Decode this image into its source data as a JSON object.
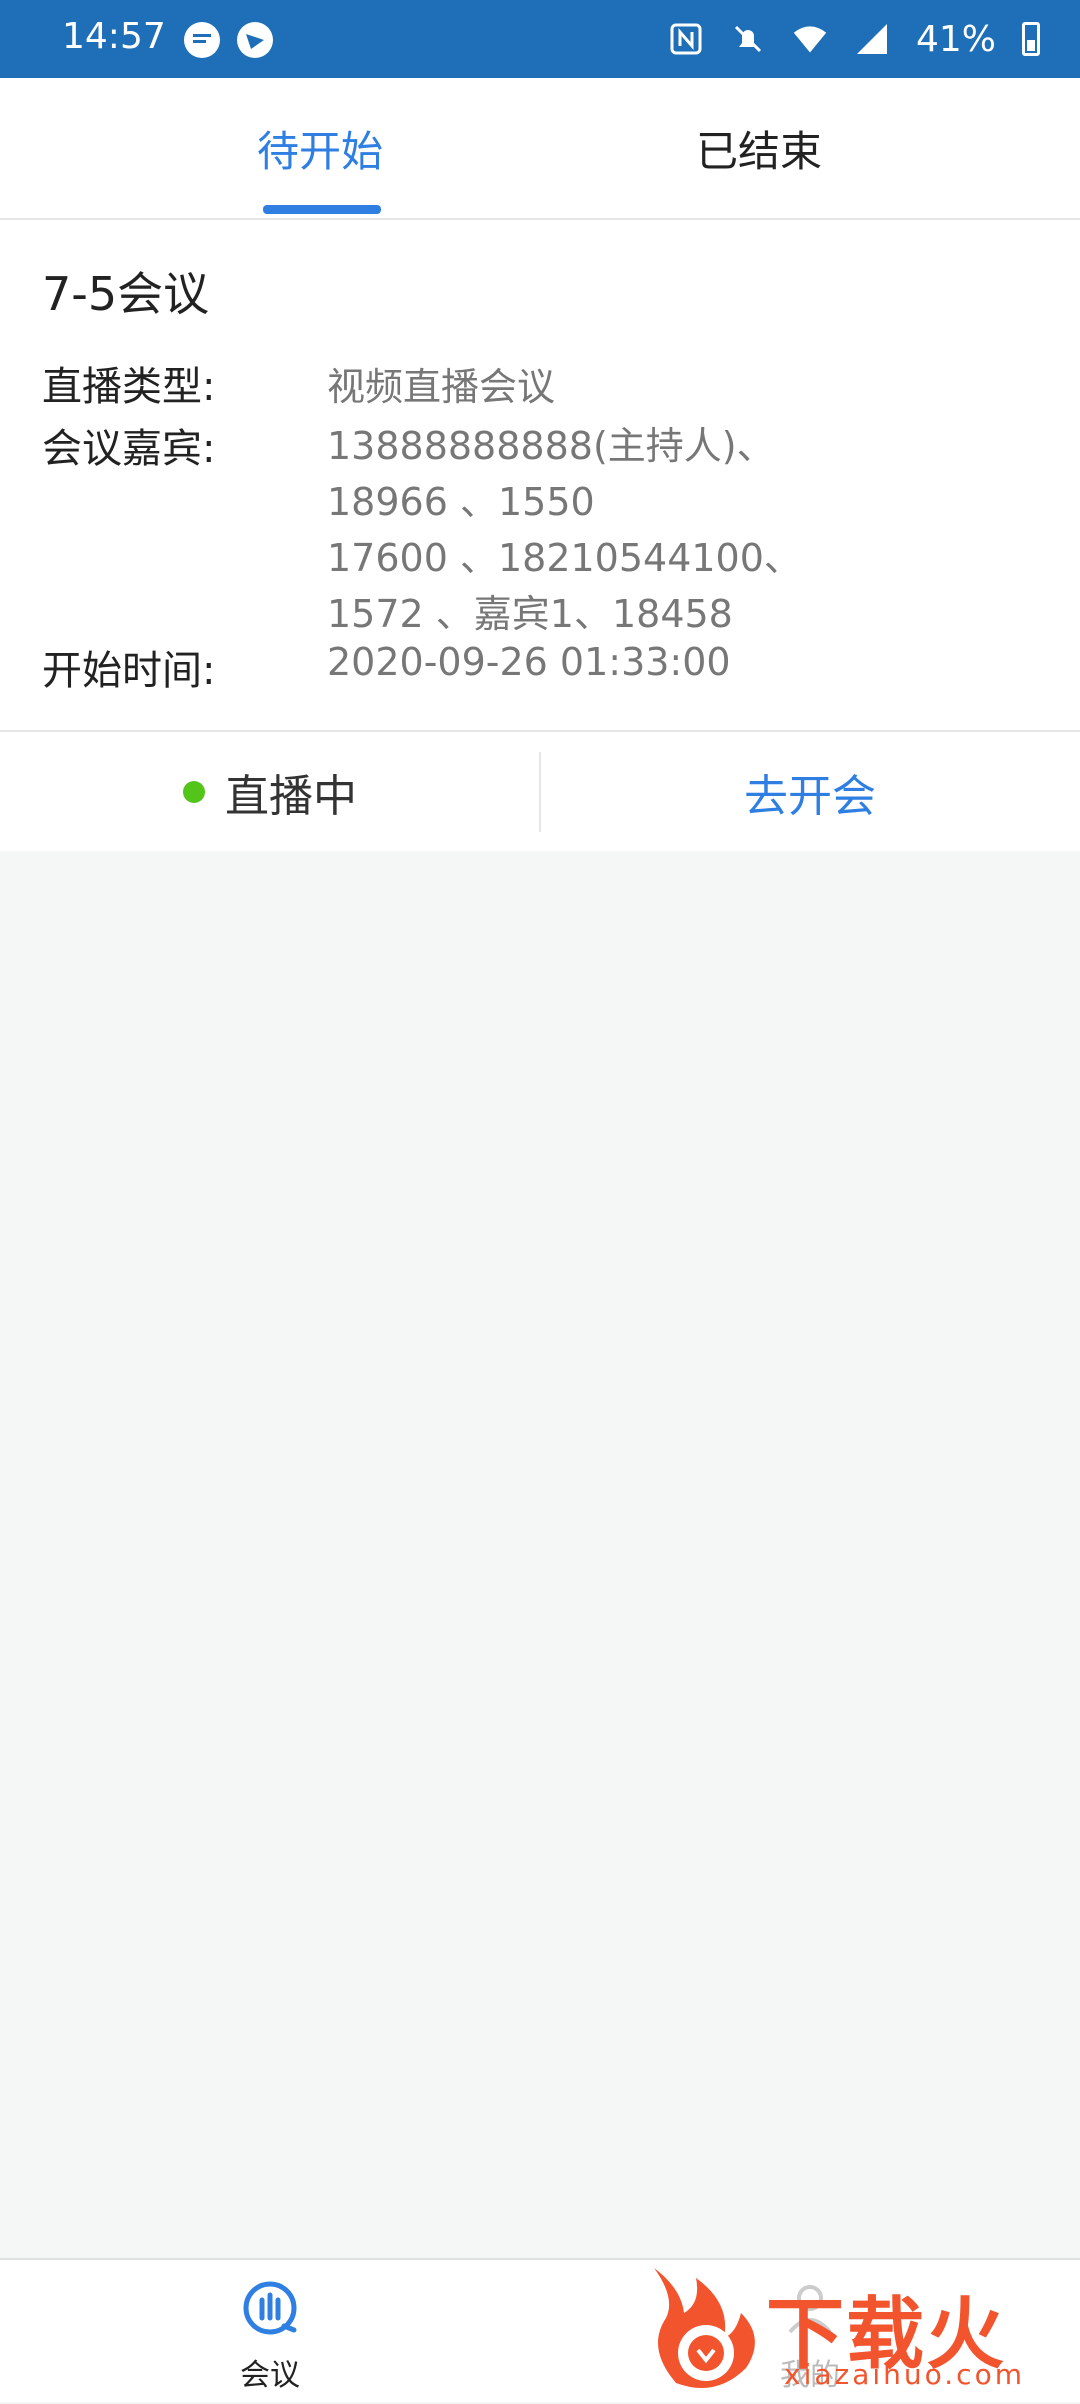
{
  "status_bar": {
    "time": "14:57",
    "battery": "41%",
    "icons": [
      "message-icon",
      "bird-icon",
      "nfc-icon",
      "mute-icon",
      "wifi-icon",
      "signal-icon",
      "battery-icon"
    ]
  },
  "tabs": [
    {
      "label": "待开始",
      "active": true
    },
    {
      "label": "已结束",
      "active": false
    }
  ],
  "meeting": {
    "title": "7-5会议",
    "type_label": "直播类型:",
    "type_value": "视频直播会议",
    "guests_label": "会议嘉宾:",
    "guests_lines": [
      "13888888888(主持人)、",
      "18966          、1550          ",
      "17600          、18210544100、",
      "1572          、嘉宾1、18458          "
    ],
    "start_label": "开始时间:",
    "start_value": "2020-09-26 01:33:00",
    "status_text": "直播中",
    "join_label": "去开会"
  },
  "bottom_nav": [
    {
      "label": "会议",
      "icon": "meeting-icon",
      "active": true
    },
    {
      "label": "我的",
      "icon": "person-icon",
      "active": false
    }
  ],
  "watermark": {
    "title": "下载火",
    "url": "xiazaihuo.com"
  },
  "colors": {
    "accent": "#2f7fe3",
    "status_bar": "#1f6fb8",
    "live_dot": "#52c41a",
    "watermark": "#f2542d"
  }
}
